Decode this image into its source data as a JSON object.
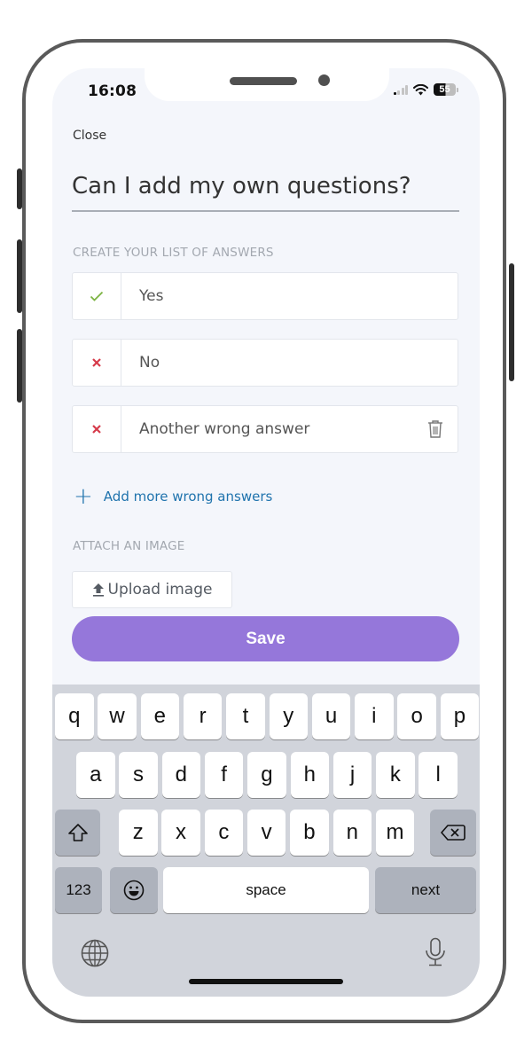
{
  "status_bar": {
    "time": "16:08",
    "battery": "55",
    "signal_icon": "cellular-signal-icon",
    "wifi_icon": "wifi-icon"
  },
  "header": {
    "close_label": "Close"
  },
  "question": {
    "value": "Can I add my own questions?"
  },
  "answers_section": {
    "label": "CREATE YOUR LIST OF ANSWERS",
    "answers": [
      {
        "text": "Yes",
        "correct": true,
        "icon": "check-icon",
        "color": "#7cb342"
      },
      {
        "text": "No",
        "correct": false,
        "icon": "x-icon",
        "color": "#d63a4a"
      },
      {
        "text": "Another wrong answer",
        "correct": false,
        "icon": "x-icon",
        "color": "#d63a4a",
        "deletable": true
      }
    ],
    "add_more_label": "Add more wrong answers",
    "link_color": "#1f73ad"
  },
  "image_section": {
    "label": "ATTACH AN IMAGE",
    "upload_label": "Upload image"
  },
  "save_button": {
    "label": "Save",
    "color": "#9577da"
  },
  "keyboard": {
    "row1": [
      "q",
      "w",
      "e",
      "r",
      "t",
      "y",
      "u",
      "i",
      "o",
      "p"
    ],
    "row2": [
      "a",
      "s",
      "d",
      "f",
      "g",
      "h",
      "j",
      "k",
      "l"
    ],
    "row3": [
      "z",
      "x",
      "c",
      "v",
      "b",
      "n",
      "m"
    ],
    "numbers_label": "123",
    "space_label": "space",
    "return_label": "next"
  }
}
